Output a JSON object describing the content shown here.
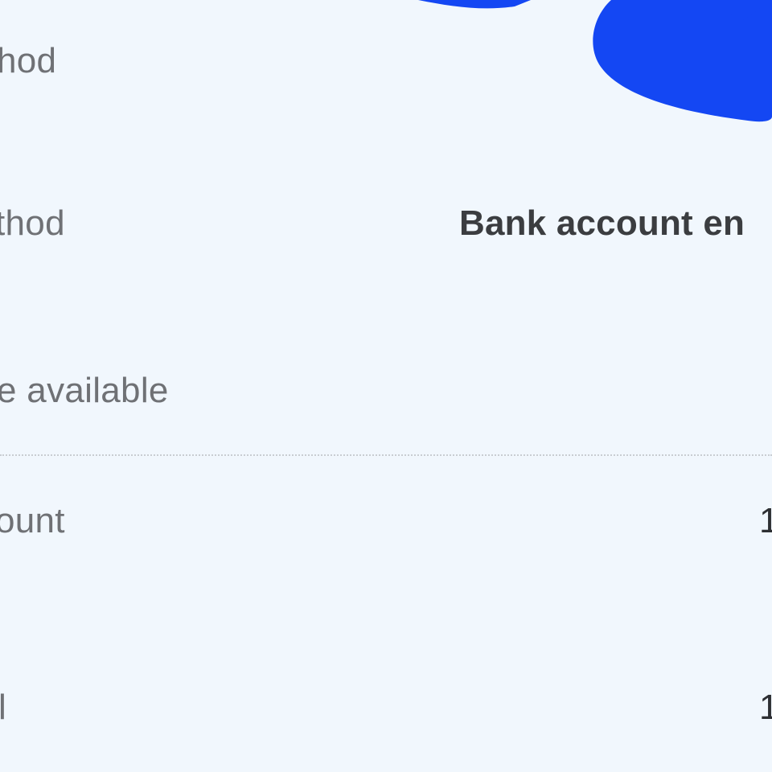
{
  "colors": {
    "background": "#f1f7fd",
    "scribble": "#1447f3",
    "label_text": "#6f7175",
    "value_text": "#3b3d40",
    "divider": "#c9cdd2"
  },
  "rows": {
    "method": {
      "label": "hod"
    },
    "payment_method": {
      "label": "thod",
      "value": "Bank account en"
    },
    "available": {
      "label": "e available"
    },
    "amount": {
      "label": "ount",
      "value": "1"
    },
    "total": {
      "label": "l",
      "value": "1"
    }
  },
  "icons": {
    "scribble": "redaction-scribble"
  }
}
